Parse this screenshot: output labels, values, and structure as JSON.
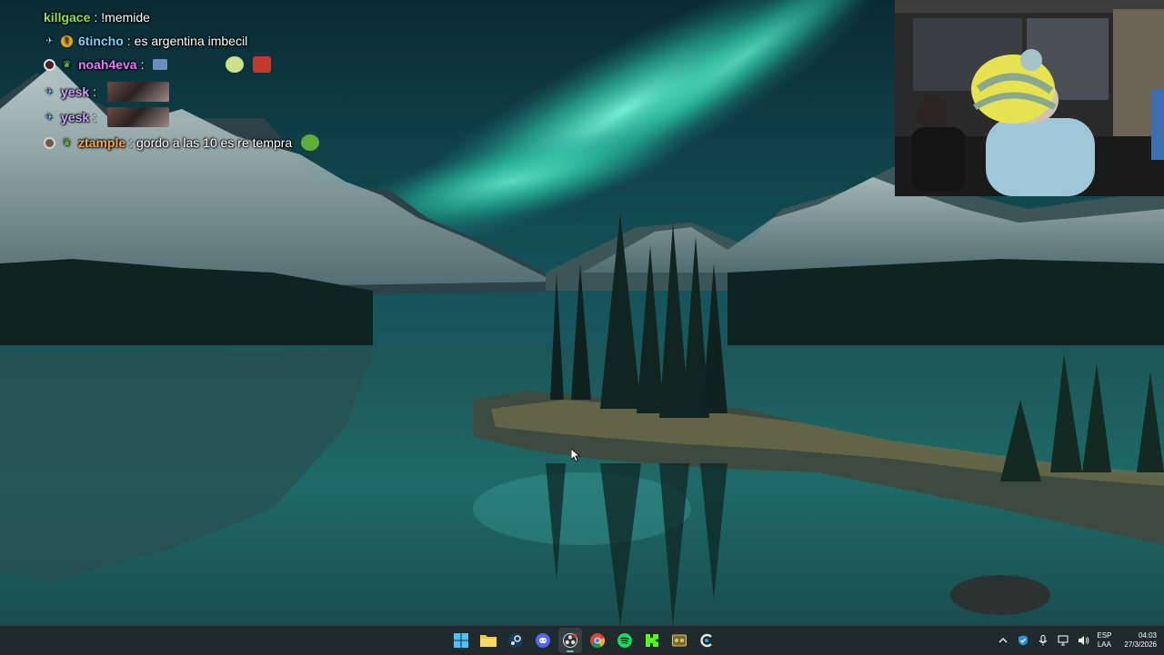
{
  "chat": {
    "messages": [
      {
        "user": "killgace",
        "text": "!memide",
        "color": "#8fe04a"
      },
      {
        "user": "6tincho",
        "text": "es argentina imbecil",
        "color": "#7fd0ff",
        "badges": [
          "pin-badge",
          "coin-badge"
        ]
      },
      {
        "user": "noah4eva",
        "text": "",
        "color": "#e67aff",
        "badges": [
          "moderator-badge",
          "frog-badge"
        ],
        "emotes": [
          "tv-emote",
          "frog-tag-emote",
          "hat-emote"
        ]
      },
      {
        "user": "yesk",
        "text": "",
        "color": "#c8a2ff",
        "badges": [
          "pin-badge"
        ],
        "emotes": [
          "photo-emote"
        ]
      },
      {
        "user": "yesk",
        "text": "",
        "color": "#c8a2ff",
        "badges": [
          "pin-badge"
        ],
        "emotes": [
          "photo-emote"
        ]
      },
      {
        "user": "ztample",
        "text": "gordo a las 10 es re tempra",
        "color": "#f1a94a",
        "badges": [
          "moderator-badge",
          "frog-badge"
        ],
        "emotes": [
          "pepe-emote"
        ]
      }
    ]
  },
  "taskbar": {
    "apps": [
      {
        "name": "start",
        "icon": "windows-icon"
      },
      {
        "name": "file-explorer",
        "icon": "folder-icon"
      },
      {
        "name": "steam",
        "icon": "steam-icon"
      },
      {
        "name": "discord",
        "icon": "discord-icon"
      },
      {
        "name": "obs",
        "icon": "obs-icon",
        "active": true
      },
      {
        "name": "chrome",
        "icon": "chrome-icon"
      },
      {
        "name": "spotify",
        "icon": "spotify-icon"
      },
      {
        "name": "kick",
        "icon": "kick-icon"
      },
      {
        "name": "game",
        "icon": "game-icon"
      },
      {
        "name": "ccleaner",
        "icon": "ccleaner-icon"
      }
    ],
    "tray": {
      "icons": [
        "chevron-up-icon",
        "defender-icon",
        "microphone-icon",
        "network-icon",
        "volume-icon"
      ],
      "language": {
        "code": "ESP",
        "layout": "LAA"
      },
      "time": "04:03",
      "date": "27/3/2026"
    }
  },
  "colors": {
    "taskbar_bg": "#1f2a2d",
    "aurora": "#3ff0c2"
  }
}
